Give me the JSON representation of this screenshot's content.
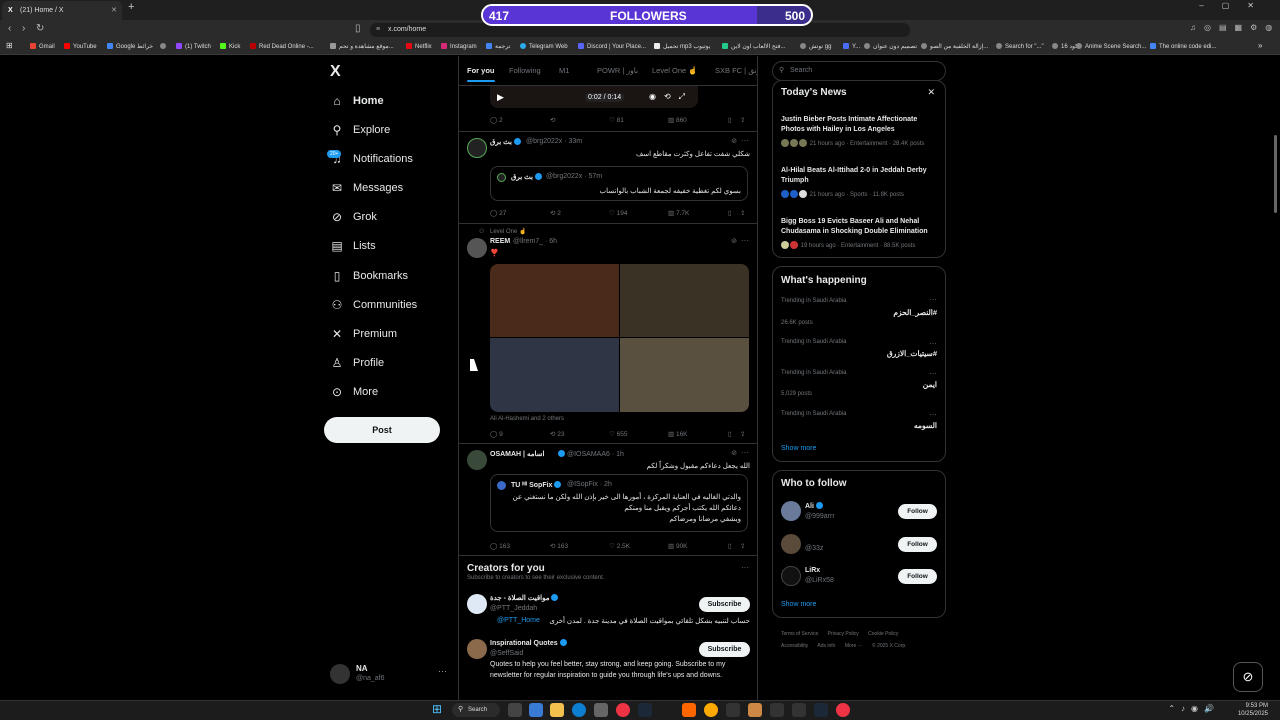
{
  "browser": {
    "tab_title": "(21) Home / X",
    "tab_favicon": "X",
    "url": "x.com/home",
    "bookmarks": [
      "Gmail",
      "YouTube",
      "Google خرائط",
      "",
      "(1) Twitch",
      "Kick",
      "Red Dead Online -...",
      "موقع مشاهدة و تحم...",
      "Netflix",
      "Instagram",
      "ترجمة",
      "Telegram Web",
      "Discord | Your Place...",
      "تحميل mp3 يوتيوب",
      "فتح الالعاب اون لاين...",
      "توتش gg",
      "Y...",
      "تصميم دون عنوان",
      "إزالة الخلفية من الصو...",
      "Search for \"...\"",
      "كود 16",
      "Anime Scene Search...",
      "The online code edi..."
    ]
  },
  "followers_overlay": {
    "current": "417",
    "label": "FOLLOWERS",
    "goal": "500",
    "progress": 0.834
  },
  "sidebar": {
    "logo": "X",
    "items": [
      {
        "label": "Home",
        "icon": "home-icon",
        "badge": ""
      },
      {
        "label": "Explore",
        "icon": "search-icon",
        "badge": ""
      },
      {
        "label": "Notifications",
        "icon": "bell-icon",
        "badge": "20+"
      },
      {
        "label": "Messages",
        "icon": "mail-icon",
        "badge": ""
      },
      {
        "label": "Grok",
        "icon": "grok-icon",
        "badge": ""
      },
      {
        "label": "Lists",
        "icon": "list-icon",
        "badge": ""
      },
      {
        "label": "Bookmarks",
        "icon": "bookmark-icon",
        "badge": ""
      },
      {
        "label": "Communities",
        "icon": "people-icon",
        "badge": ""
      },
      {
        "label": "Premium",
        "icon": "x-icon",
        "badge": ""
      },
      {
        "label": "Profile",
        "icon": "person-icon",
        "badge": ""
      },
      {
        "label": "More",
        "icon": "more-circle-icon",
        "badge": ""
      }
    ],
    "post_button": "Post",
    "account": {
      "name": "NA",
      "handle": "@na_af6"
    }
  },
  "feed": {
    "tabs": [
      "For you",
      "Following",
      "M1",
      "POWR | باور",
      "Level One ☝️",
      "SXB FC | ونق"
    ],
    "video": {
      "time": "0:02 / 0:14",
      "stats": [
        "2",
        "",
        "81",
        "860"
      ]
    },
    "post1": {
      "name": "بث برق",
      "handle": "@brg2022x · 33m",
      "text": "شكلي شفت تفاعل وكثرت مقاطع اسف",
      "quote": {
        "name": "بث برق",
        "handle": "@brg2022x · 57m",
        "text": "بسوي لكم تغطية خفيفه لجمعة الشباب بالواتساب"
      },
      "stats": [
        "27",
        "2",
        "194",
        "7.7K"
      ]
    },
    "post2": {
      "community": "Level One ☝️",
      "name": "REEM",
      "handle": "@llrem7_ · 6h",
      "text": "❣️",
      "tagged": "Ali Al-Hashemi and 2 others",
      "stats": [
        "9",
        "23",
        "655",
        "16K"
      ]
    },
    "post3": {
      "name": "OSAMAH | اسامه",
      "handle": "@IOSAMAA6 · 1h",
      "text": "الله يجعل دعاءكم مقبول وشكراً لكم",
      "quote": {
        "name": "TU ᴹᴵ SopFix",
        "handle": "@ISopFix · 2h",
        "lines": [
          "والدتي الغاليه في العناية المركزة ، أمورها الى خير بإذن الله ولكن ما نستغني عن",
          "دعائكم الله يكتب أجركم ويقبل منا ومنكم",
          "ويشفي مرضانا ومرضاكم"
        ]
      },
      "stats": [
        "163",
        "163",
        "2.5K",
        "90K"
      ]
    },
    "creators": {
      "title": "Creators for you",
      "subtitle": "Subscribe to creators to see their exclusive content.",
      "button": "Subscribe",
      "items": [
        {
          "name": "مواقيت الصلاة - جدة",
          "handle": "@PTT_Jeddah",
          "bio": "حساب لتنبيه بشكل تلقائي بمواقيت الصلاة في مدينة جدة . لمدن أخرى",
          "bio_link": "@PTT_Home"
        },
        {
          "name": "Inspirational Quotes",
          "handle": "@SeffSaid",
          "bio1": "Quotes to help you feel better, stay strong, and keep going. Subscribe to my",
          "bio2": "newsletter for regular inspiration to guide you through life's ups and downs."
        }
      ]
    }
  },
  "right": {
    "search_placeholder": "Search",
    "news": {
      "title": "Today's News",
      "items": [
        {
          "headline": "Justin Bieber Posts Intimate Affectionate Photos with Hailey in Los Angeles",
          "meta": "21 hours ago · Entertainment · 28.4K posts"
        },
        {
          "headline": "Al-Hilal Beats Al-Ittihad 2-0 in Jeddah Derby Triumph",
          "meta": "21 hours ago · Sports · 11.8K posts"
        },
        {
          "headline": "Bigg Boss 19 Evicts Baseer Ali and Nehal Chudasama in Shocking Double Elimination",
          "meta": "19 hours ago · Entertainment · 88.5K posts"
        }
      ]
    },
    "happening": {
      "title": "What's happening",
      "show_more": "Show more",
      "items": [
        {
          "loc": "Trending in Saudi Arabia",
          "name": "#النصر_الحزم",
          "posts": "26.6K posts"
        },
        {
          "loc": "Trending in Saudi Arabia",
          "name": "#سيتيات_الازرق",
          "posts": ""
        },
        {
          "loc": "Trending in Saudi Arabia",
          "name": "ايمن",
          "posts": "5,029 posts"
        },
        {
          "loc": "Trending in Saudi Arabia",
          "name": "السومه",
          "posts": ""
        }
      ]
    },
    "follow": {
      "title": "Who to follow",
      "button": "Follow",
      "show_more": "Show more",
      "items": [
        {
          "name": "Ali",
          "handle": "@999arrr"
        },
        {
          "name": "",
          "handle": "@33z"
        },
        {
          "name": "LiRx",
          "handle": "@LiRx58"
        }
      ]
    },
    "footer": [
      "Terms of Service",
      "Privacy Policy",
      "Cookie Policy",
      "Accessibility",
      "Ads info",
      "More ···",
      "© 2025 X Corp."
    ]
  },
  "taskbar": {
    "search": "Search",
    "time": "9:53 PM",
    "date": "10/25/2025"
  }
}
